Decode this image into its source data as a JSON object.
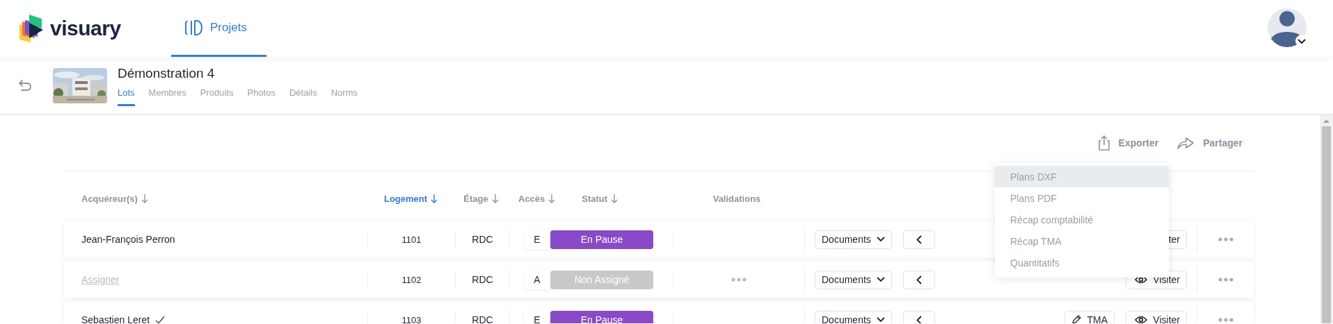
{
  "header": {
    "brand": "visuary",
    "nav": [
      {
        "label": "Projets",
        "selected": true
      }
    ]
  },
  "project": {
    "title": "Démonstration 4",
    "tabs": [
      {
        "label": "Lots",
        "selected": true
      },
      {
        "label": "Membres",
        "selected": false
      },
      {
        "label": "Produits",
        "selected": false
      },
      {
        "label": "Photos",
        "selected": false
      },
      {
        "label": "Détails",
        "selected": false
      },
      {
        "label": "Norms",
        "selected": false
      }
    ]
  },
  "toolbar": {
    "export": "Exporter",
    "share": "Partager"
  },
  "export_menu": [
    {
      "label": "Plans DXF",
      "selected": true
    },
    {
      "label": "Plans PDF",
      "selected": false
    },
    {
      "label": "Récap comptabilité",
      "selected": false
    },
    {
      "label": "Récap TMA",
      "selected": false
    },
    {
      "label": "Quantitatifs",
      "selected": false
    }
  ],
  "table": {
    "columns": [
      {
        "label": "Acquéreur(s)",
        "sorted": false,
        "kind": "buyer"
      },
      {
        "label": "Logement",
        "sorted": true,
        "kind": "unit"
      },
      {
        "label": "Étage",
        "sorted": false,
        "kind": "floor"
      },
      {
        "label": "Accès",
        "sorted": false,
        "kind": "access"
      },
      {
        "label": "Statut",
        "sorted": false,
        "kind": "status"
      },
      {
        "label": "Validations",
        "kind": "validations"
      }
    ],
    "rows": [
      {
        "buyer": {
          "text": "Jean-François Perron",
          "kind": "name"
        },
        "verified": false,
        "unit": "1101",
        "floor": "RDC",
        "access": "E",
        "status": {
          "label": "En Pause",
          "color": "#8b48c9"
        },
        "validations_pending": false,
        "documents": "Documents",
        "visit": {
          "label": "ter"
        }
      },
      {
        "buyer": {
          "text": "Assigner",
          "kind": "link"
        },
        "verified": false,
        "unit": "1102",
        "floor": "RDC",
        "access": "A",
        "status": {
          "label": "Non Assigné",
          "color": "#c9c9c9"
        },
        "validations_pending": true,
        "documents": "Documents",
        "visit": {
          "label": "Visiter",
          "icon": true
        }
      },
      {
        "buyer": {
          "text": "Sebastien Leret",
          "kind": "name"
        },
        "verified": true,
        "unit": "1103",
        "floor": "RDC",
        "access": "E",
        "status": {
          "label": "En Pause",
          "color": "#8b48c9"
        },
        "validations_pending": false,
        "documents": "Documents",
        "tma": "TMA",
        "visit": {
          "label": "Visiter",
          "icon": true
        }
      }
    ]
  }
}
